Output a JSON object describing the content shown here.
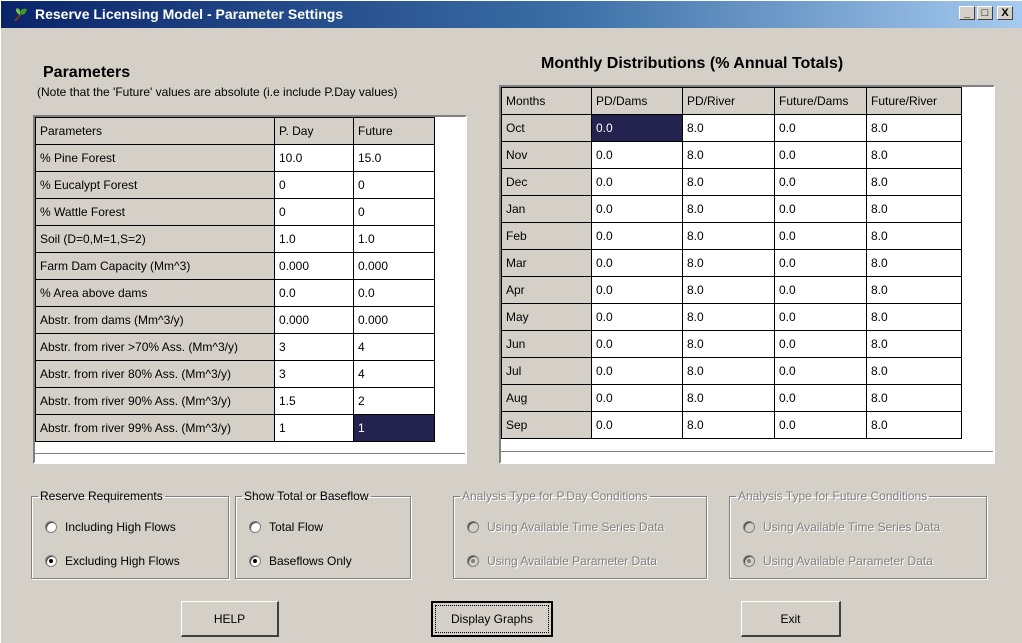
{
  "window": {
    "title": "Reserve Licensing Model - Parameter Settings",
    "controls": [
      "_",
      "□",
      "X"
    ]
  },
  "parameters": {
    "heading": "Parameters",
    "note": "(Note that the 'Future' values are absolute (i.e include P.Day values)",
    "columns": [
      "Parameters",
      "P. Day",
      "Future"
    ],
    "rows": [
      {
        "name": "% Pine Forest",
        "pday": "10.0",
        "future": "15.0"
      },
      {
        "name": "% Eucalypt Forest",
        "pday": "0",
        "future": "0"
      },
      {
        "name": "% Wattle Forest",
        "pday": "0",
        "future": "0"
      },
      {
        "name": "Soil (D=0,M=1,S=2)",
        "pday": "1.0",
        "future": "1.0"
      },
      {
        "name": "Farm Dam Capacity (Mm^3)",
        "pday": "0.000",
        "future": "0.000"
      },
      {
        "name": "% Area above dams",
        "pday": "0.0",
        "future": "0.0"
      },
      {
        "name": "Abstr. from dams (Mm^3/y)",
        "pday": "0.000",
        "future": "0.000"
      },
      {
        "name": "Abstr. from river >70% Ass. (Mm^3/y)",
        "pday": "3",
        "future": "4"
      },
      {
        "name": "Abstr. from river 80% Ass. (Mm^3/y)",
        "pday": "3",
        "future": "4"
      },
      {
        "name": "Abstr. from river 90% Ass. (Mm^3/y)",
        "pday": "1.5",
        "future": "2"
      },
      {
        "name": "Abstr. from river 99% Ass. (Mm^3/y)",
        "pday": "1",
        "future": "1"
      }
    ]
  },
  "monthly": {
    "heading": "Monthly Distributions (% Annual Totals)",
    "columns": [
      "Months",
      "PD/Dams",
      "PD/River",
      "Future/Dams",
      "Future/River"
    ],
    "rows": [
      {
        "month": "Oct",
        "pd_dams": "0.0",
        "pd_river": "8.0",
        "fut_dams": "0.0",
        "fut_river": "8.0"
      },
      {
        "month": "Nov",
        "pd_dams": "0.0",
        "pd_river": "8.0",
        "fut_dams": "0.0",
        "fut_river": "8.0"
      },
      {
        "month": "Dec",
        "pd_dams": "0.0",
        "pd_river": "8.0",
        "fut_dams": "0.0",
        "fut_river": "8.0"
      },
      {
        "month": "Jan",
        "pd_dams": "0.0",
        "pd_river": "8.0",
        "fut_dams": "0.0",
        "fut_river": "8.0"
      },
      {
        "month": "Feb",
        "pd_dams": "0.0",
        "pd_river": "8.0",
        "fut_dams": "0.0",
        "fut_river": "8.0"
      },
      {
        "month": "Mar",
        "pd_dams": "0.0",
        "pd_river": "8.0",
        "fut_dams": "0.0",
        "fut_river": "8.0"
      },
      {
        "month": "Apr",
        "pd_dams": "0.0",
        "pd_river": "8.0",
        "fut_dams": "0.0",
        "fut_river": "8.0"
      },
      {
        "month": "May",
        "pd_dams": "0.0",
        "pd_river": "8.0",
        "fut_dams": "0.0",
        "fut_river": "8.0"
      },
      {
        "month": "Jun",
        "pd_dams": "0.0",
        "pd_river": "8.0",
        "fut_dams": "0.0",
        "fut_river": "8.0"
      },
      {
        "month": "Jul",
        "pd_dams": "0.0",
        "pd_river": "8.0",
        "fut_dams": "0.0",
        "fut_river": "8.0"
      },
      {
        "month": "Aug",
        "pd_dams": "0.0",
        "pd_river": "8.0",
        "fut_dams": "0.0",
        "fut_river": "8.0"
      },
      {
        "month": "Sep",
        "pd_dams": "0.0",
        "pd_river": "8.0",
        "fut_dams": "0.0",
        "fut_river": "8.0"
      }
    ]
  },
  "groups": {
    "reserve": {
      "label": "Reserve Requirements",
      "options": [
        "Including High Flows",
        "Excluding High Flows"
      ],
      "selected": 1
    },
    "flow": {
      "label": "Show Total or Baseflow",
      "options": [
        "Total Flow",
        "Baseflows Only"
      ],
      "selected": 1
    },
    "analysis_pday": {
      "label": "Analysis Type for P.Day Conditions",
      "options": [
        "Using Available Time Series Data",
        "Using Available Parameter Data"
      ],
      "selected": 1
    },
    "analysis_future": {
      "label": "Analysis Type for Future Conditions",
      "options": [
        "Using Available Time Series Data",
        "Using Available Parameter Data"
      ],
      "selected": 1
    }
  },
  "buttons": {
    "help": "HELP",
    "display_graphs": "Display Graphs",
    "exit": "Exit"
  },
  "colors": {
    "titlebar_start": "#0a246a",
    "titlebar_end": "#a6caf0",
    "face": "#d4d0c8",
    "selection": "#24224f"
  }
}
